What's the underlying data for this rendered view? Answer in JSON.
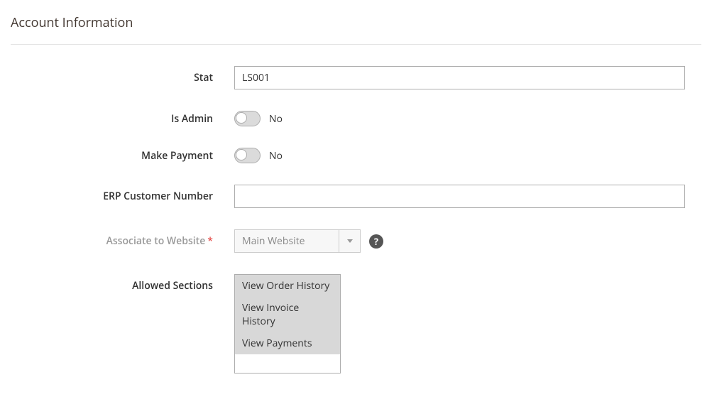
{
  "section": {
    "title": "Account Information"
  },
  "fields": {
    "stat": {
      "label": "Stat",
      "value": "LS001"
    },
    "is_admin": {
      "label": "Is Admin",
      "value_label": "No"
    },
    "make_payment": {
      "label": "Make Payment",
      "value_label": "No"
    },
    "erp_customer_number": {
      "label": "ERP Customer Number",
      "value": ""
    },
    "associate_to_website": {
      "label": "Associate to Website",
      "selected": "Main Website"
    },
    "allowed_sections": {
      "label": "Allowed Sections",
      "options": {
        "0": "View Order History",
        "1": "View Invoice History",
        "2": "View Payments"
      }
    }
  }
}
